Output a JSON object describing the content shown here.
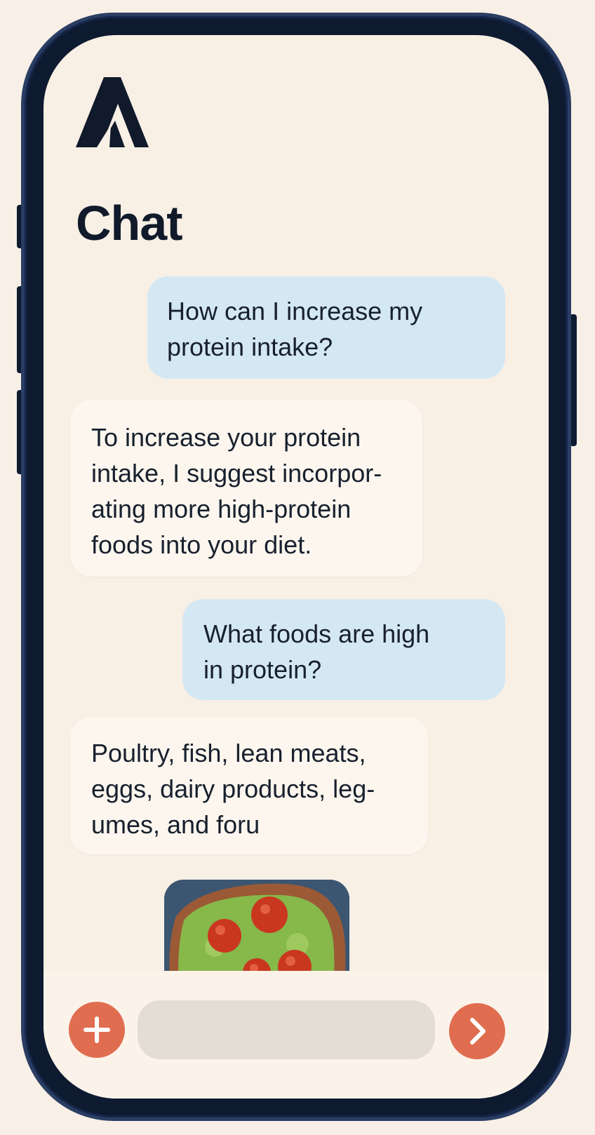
{
  "app": {
    "logo_name": "a-logo",
    "title": "Chat"
  },
  "messages": [
    {
      "role": "user",
      "text": "How can I increase my\nprotein intake?"
    },
    {
      "role": "assistant",
      "text": "To increase your protein\nintake, I suggest incorpor-\nating more high-protein\nfoods into your diet."
    },
    {
      "role": "user",
      "text": "What foods are high\nin protein?"
    },
    {
      "role": "assistant",
      "text": "Poultry, fish, lean meats,\neggs, dairy products, leg-\numes, and foru"
    }
  ],
  "attachment": {
    "type": "image",
    "subject": "avocado-toast-with-tomatoes"
  },
  "composer": {
    "add_icon": "plus-icon",
    "input_value": "",
    "input_placeholder": "",
    "send_icon": "chevron-right-icon"
  },
  "colors": {
    "background": "#f8efe6",
    "phone_frame": "#0e1a30",
    "user_bubble": "#d4e8f4",
    "assistant_bubble": "#fcf6ee",
    "accent": "#e16d50",
    "title_text": "#111a2b"
  }
}
